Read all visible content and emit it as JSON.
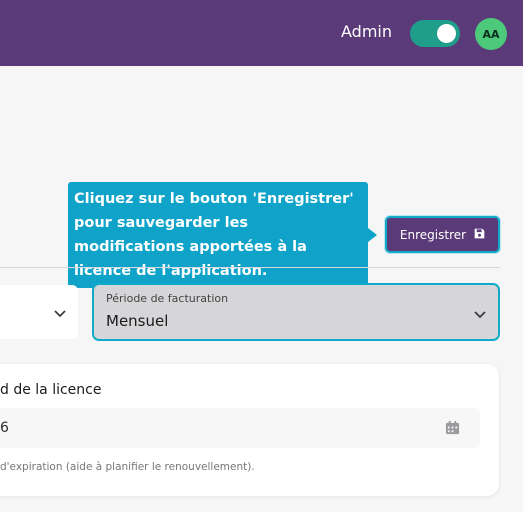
{
  "header": {
    "admin_label": "Admin",
    "avatar_initials": "AA",
    "toggle_on": true
  },
  "tooltip": {
    "text": "Cliquez sur le bouton 'Enregistrer' pour sauvegarder les modifications apportées à la licence de l'application."
  },
  "save_button": {
    "label": "Enregistrer",
    "icon": "floppy-disk-icon"
  },
  "billing": {
    "period_label": "Période de facturation",
    "period_value": "Mensuel"
  },
  "license_card": {
    "title": "d de la licence",
    "date_value": "6",
    "help_text": "d'expiration (aide à planifier le renouvellement)."
  },
  "colors": {
    "header_bg": "#5a3a78",
    "accent": "#12aac9",
    "toggle_on": "#1e9e8b",
    "avatar_bg": "#4cc97a"
  }
}
